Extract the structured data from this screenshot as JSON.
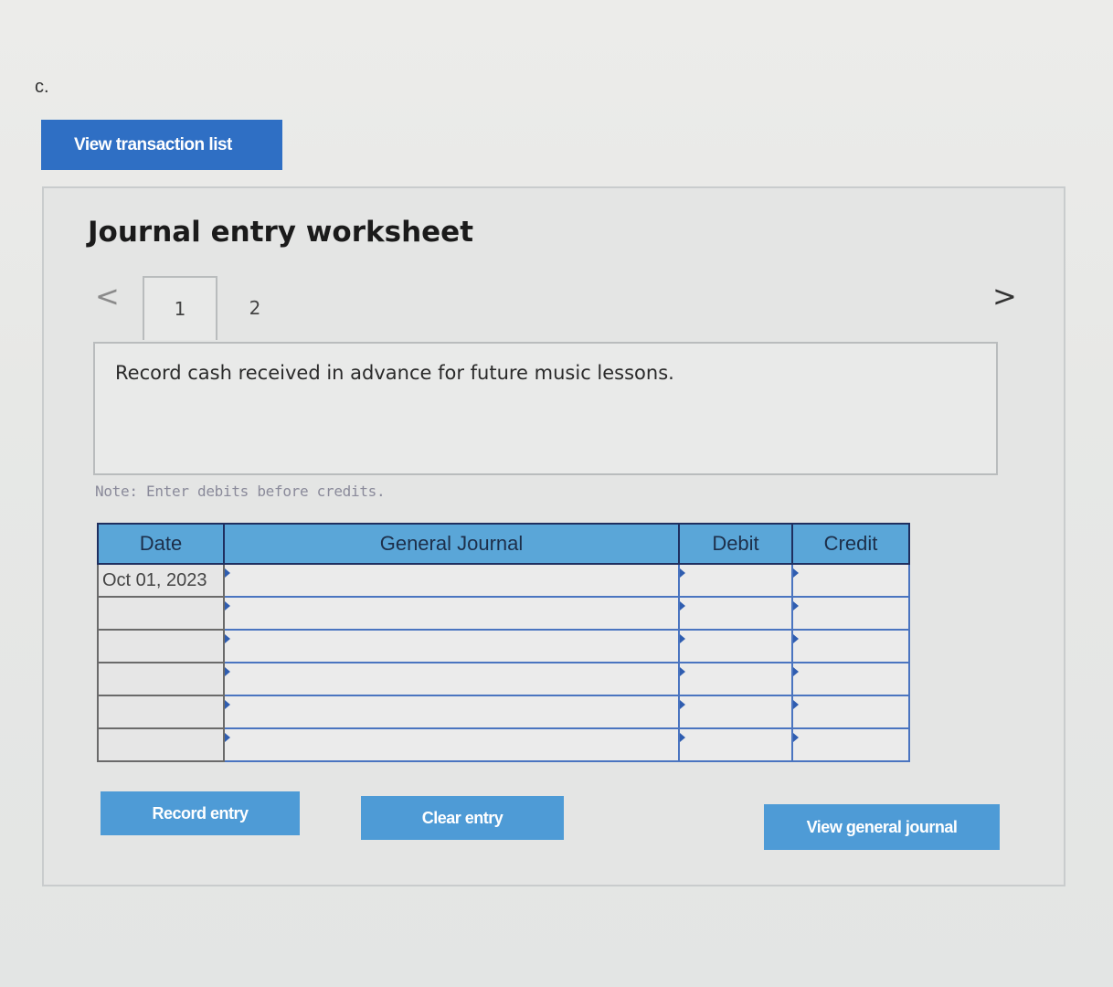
{
  "part_label": "c.",
  "view_transaction_list_label": "View transaction list",
  "worksheet": {
    "title": "Journal entry worksheet",
    "nav_prev": "<",
    "nav_next": ">",
    "tabs": [
      {
        "label": "1",
        "active": true
      },
      {
        "label": "2",
        "active": false
      }
    ],
    "description": "Record cash received in advance for future music lessons.",
    "note": "Note: Enter debits before credits."
  },
  "table": {
    "headers": {
      "date": "Date",
      "general_journal": "General Journal",
      "debit": "Debit",
      "credit": "Credit"
    },
    "rows": [
      {
        "date": "Oct 01, 2023",
        "account": "",
        "debit": "",
        "credit": ""
      },
      {
        "date": "",
        "account": "",
        "debit": "",
        "credit": ""
      },
      {
        "date": "",
        "account": "",
        "debit": "",
        "credit": ""
      },
      {
        "date": "",
        "account": "",
        "debit": "",
        "credit": ""
      },
      {
        "date": "",
        "account": "",
        "debit": "",
        "credit": ""
      },
      {
        "date": "",
        "account": "",
        "debit": "",
        "credit": ""
      }
    ]
  },
  "buttons": {
    "record_entry": "Record entry",
    "clear_entry": "Clear entry",
    "view_general_journal": "View general journal"
  },
  "colors": {
    "primary_button": "#2f6fc4",
    "action_button": "#4e9bd6",
    "table_header": "#5aa6d8",
    "table_border": "#4a74c0"
  }
}
